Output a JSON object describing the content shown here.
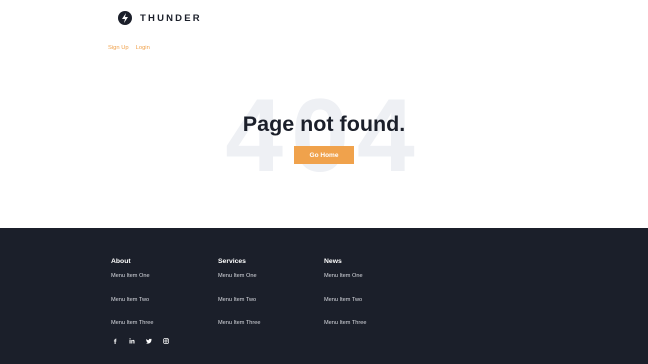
{
  "brand": {
    "name": "THUNDER"
  },
  "auth": {
    "signup": "Sign Up",
    "login": "Login"
  },
  "hero": {
    "background_text": "404",
    "title": "Page not found.",
    "button": "Go Home"
  },
  "footer": {
    "columns": [
      {
        "title": "About",
        "items": [
          "Menu Item One",
          "Menu Item Two",
          "Menu Item Three"
        ]
      },
      {
        "title": "Services",
        "items": [
          "Menu Item One",
          "Menu Item Two",
          "Menu Item Three"
        ]
      },
      {
        "title": "News",
        "items": [
          "Menu Item One",
          "Menu Item Two",
          "Menu Item Three"
        ]
      }
    ],
    "social": [
      "facebook-icon",
      "linkedin-icon",
      "twitter-icon",
      "instagram-icon"
    ]
  },
  "colors": {
    "accent": "#f0a24c",
    "dark": "#1b1f2a",
    "ghost_text": "#eef0f4"
  }
}
